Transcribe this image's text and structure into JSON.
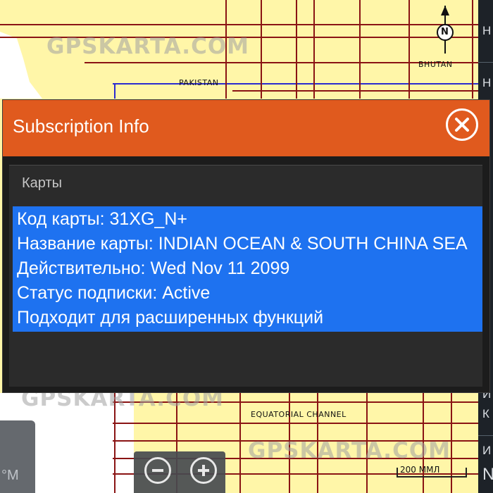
{
  "map": {
    "labels": {
      "pakistan": "PAKISTAN",
      "bhutan": "BHUTAN",
      "equatorial_channel": "EQUATORIAL CHANNEL"
    },
    "scale": "200 ММЛ",
    "compass_letter": "N"
  },
  "watermark": "GPSKARTA.COM",
  "right_panel": {
    "items": [
      "Н",
      "Н",
      "И",
      "К",
      "И",
      "N"
    ]
  },
  "dialog": {
    "title": "Subscription Info",
    "section_label": "Карты",
    "rows": [
      "Код карты:  31XG_N+",
      "Название карты:  INDIAN OCEAN & SOUTH CHINA SEA",
      "Действительно:  Wed Nov 11 2099",
      "Статус подписки: Active",
      "Подходит для расширенных функций"
    ]
  },
  "left_tab": {
    "text": "°М"
  },
  "icons": {
    "close": "close-icon",
    "zoom_out": "minus-icon",
    "zoom_in": "plus-icon",
    "compass": "north-arrow-icon"
  },
  "colors": {
    "header": "#e05a1e",
    "highlight": "#1e72f0",
    "map_land": "#fff6a8",
    "grid": "#8a1414"
  }
}
